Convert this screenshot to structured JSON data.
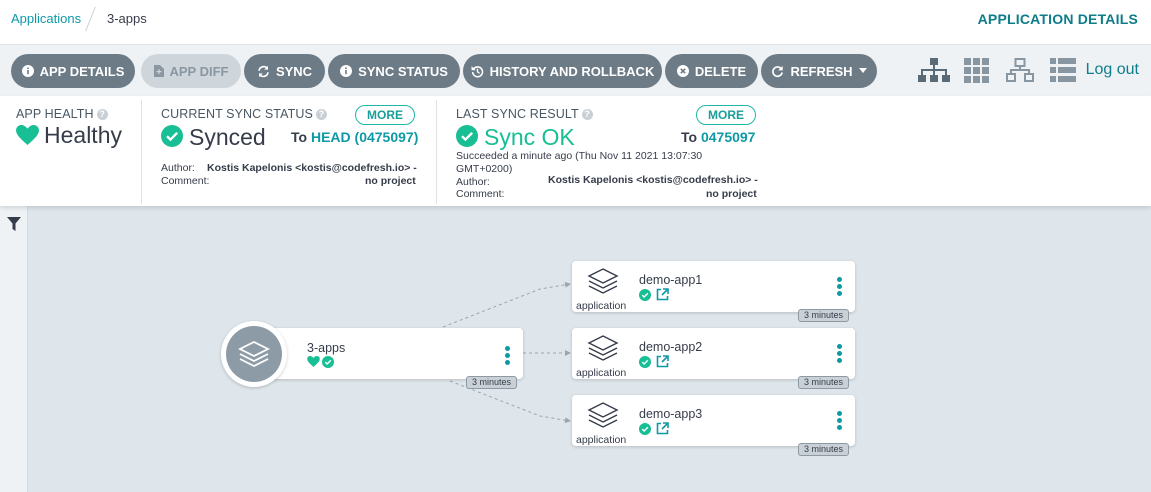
{
  "breadcrumb": {
    "parent": "Applications",
    "current": "3-apps"
  },
  "page_title": "APPLICATION DETAILS",
  "toolbar": {
    "buttons": [
      {
        "label": "APP DETAILS",
        "icon": "info-icon"
      },
      {
        "label": "APP DIFF",
        "icon": "file-diff-icon",
        "disabled": true
      },
      {
        "label": "SYNC",
        "icon": "sync-icon"
      },
      {
        "label": "SYNC STATUS",
        "icon": "info-icon"
      },
      {
        "label": "HISTORY AND ROLLBACK",
        "icon": "history-icon"
      },
      {
        "label": "DELETE",
        "icon": "delete-circle-icon"
      },
      {
        "label": "REFRESH",
        "icon": "refresh-icon"
      }
    ],
    "views": [
      "tree-view-icon",
      "pods-view-icon",
      "network-view-icon",
      "list-view-icon"
    ],
    "logout": "Log out"
  },
  "status": {
    "health": {
      "label": "APP HEALTH",
      "value": "Healthy"
    },
    "sync": {
      "label": "CURRENT SYNC STATUS",
      "value": "Synced",
      "more": "MORE",
      "to_prefix": "To",
      "to_ref": "HEAD (0475097)",
      "author_label": "Author:",
      "author": "Kostis Kapelonis <kostis@codefresh.io> -",
      "comment_label": "Comment:",
      "comment": "no project"
    },
    "last_sync": {
      "label": "LAST SYNC RESULT",
      "value": "Sync OK",
      "more": "MORE",
      "to_prefix": "To",
      "to_ref": "0475097",
      "time_line1": "Succeeded a minute ago (Thu Nov 11 2021 13:07:30",
      "time_line2": "GMT+0200)",
      "author_label": "Author:",
      "author": "Kostis Kapelonis <kostis@codefresh.io> -",
      "comment_label": "Comment:",
      "comment": "no project"
    }
  },
  "graph": {
    "root": {
      "name": "3-apps",
      "age": "3 minutes"
    },
    "children": [
      {
        "name": "demo-app1",
        "kind": "application",
        "age": "3 minutes"
      },
      {
        "name": "demo-app2",
        "kind": "application",
        "age": "3 minutes"
      },
      {
        "name": "demo-app3",
        "kind": "application",
        "age": "3 minutes"
      }
    ]
  },
  "colors": {
    "accent": "#0d9aa5",
    "healthy": "#18be94",
    "button": "#6c7b86",
    "graph_bg": "#dee6eb"
  }
}
